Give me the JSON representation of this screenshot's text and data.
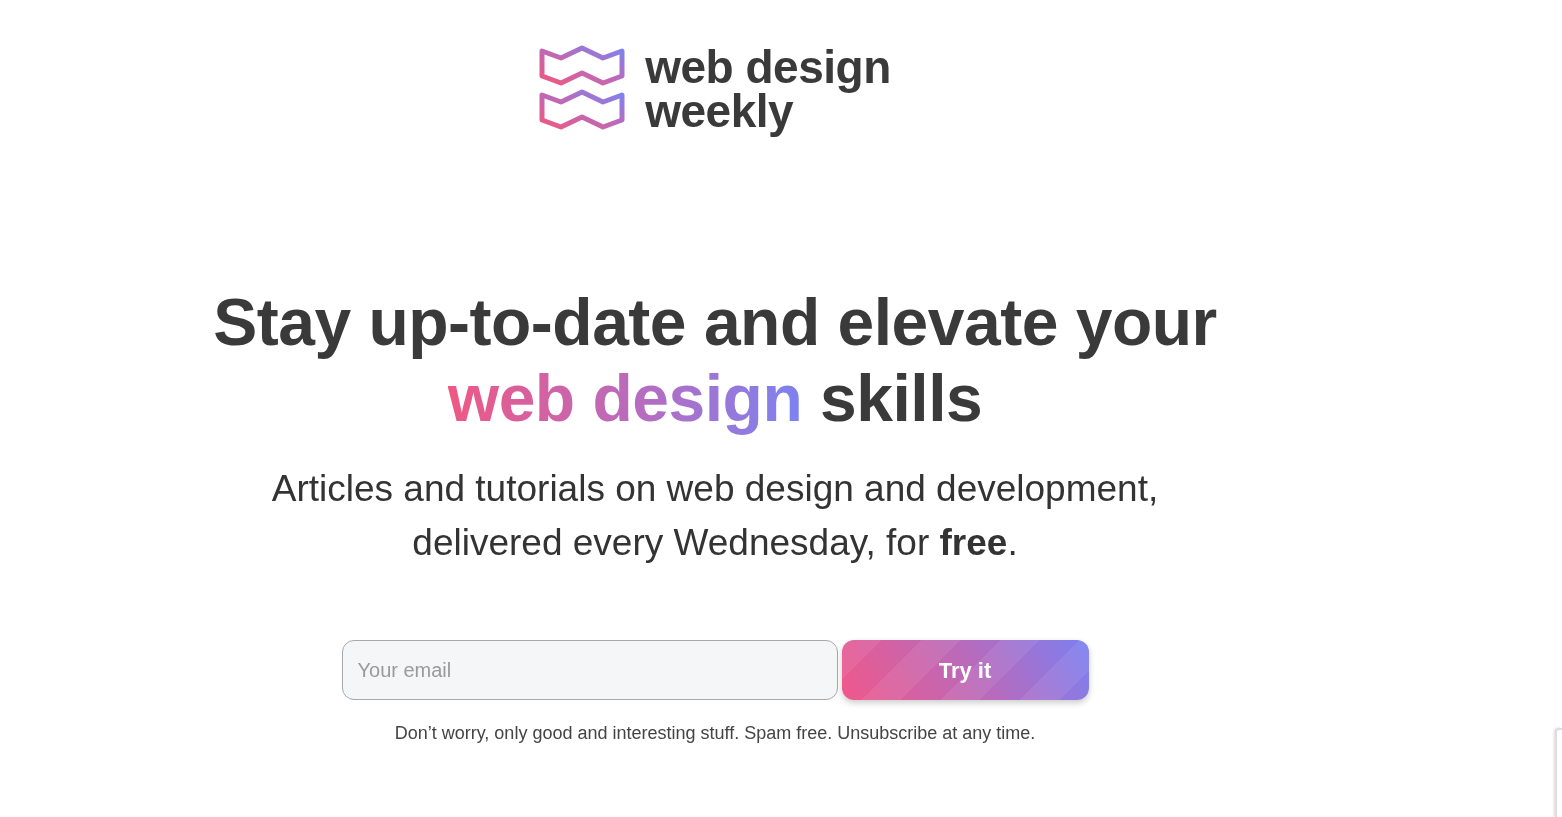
{
  "logo": {
    "lines": [
      "web design",
      "weekly"
    ]
  },
  "headline": {
    "text": "Stay up-to-date and elevate your",
    "highlight": "web design",
    "tail": "skills"
  },
  "subtitle": {
    "lines": [
      "Articles and tutorials on web design and development,",
      "delivered every Wednesday, for **free**."
    ]
  },
  "signup": {
    "email": {
      "placeholder": "Your email"
    },
    "button": "Try it",
    "note": "Don’t worry, only good and interesting stuff. Spam free. Unsubscribe at any time."
  }
}
